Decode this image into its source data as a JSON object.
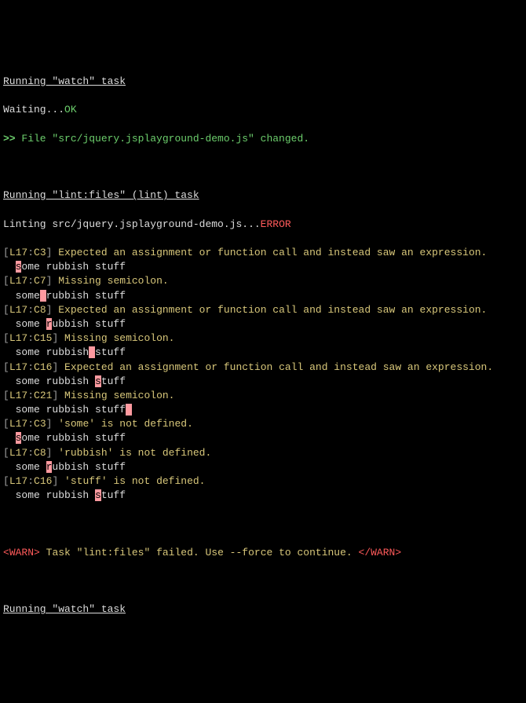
{
  "header": {
    "watch_task": "Running \"watch\" task",
    "waiting": "Waiting...",
    "ok": "OK",
    "file_changed_prefix": ">> ",
    "file_changed": "File \"src/jquery.jsplayground-demo.js\" changed."
  },
  "lint": {
    "task_header": "Running \"lint:files\" (lint) task",
    "linting_prefix": "Linting ",
    "linting_file": "src/jquery.jsplayground-demo.js",
    "linting_suffix": "...",
    "error_label": "ERROR"
  },
  "errors": [
    {
      "loc_open": "[",
      "line": "L17",
      "colon": ":",
      "col": "C3",
      "loc_close": "]",
      "msg": " Expected an assignment or function call and instead saw an expression.",
      "ctx_pre": "  ",
      "ctx_hl": "s",
      "ctx_post": "ome rubbish stuff"
    },
    {
      "loc_open": "[",
      "line": "L17",
      "colon": ":",
      "col": "C7",
      "loc_close": "]",
      "msg": " Missing semicolon.",
      "ctx_pre": "  some",
      "ctx_hl": " ",
      "ctx_post": "rubbish stuff"
    },
    {
      "loc_open": "[",
      "line": "L17",
      "colon": ":",
      "col": "C8",
      "loc_close": "]",
      "msg": " Expected an assignment or function call and instead saw an expression.",
      "ctx_pre": "  some ",
      "ctx_hl": "r",
      "ctx_post": "ubbish stuff"
    },
    {
      "loc_open": "[",
      "line": "L17",
      "colon": ":",
      "col": "C15",
      "loc_close": "]",
      "msg": " Missing semicolon.",
      "ctx_pre": "  some rubbish",
      "ctx_hl": " ",
      "ctx_post": "stuff"
    },
    {
      "loc_open": "[",
      "line": "L17",
      "colon": ":",
      "col": "C16",
      "loc_close": "]",
      "msg": " Expected an assignment or function call and instead saw an expression.",
      "ctx_pre": "  some rubbish ",
      "ctx_hl": "s",
      "ctx_post": "tuff"
    },
    {
      "loc_open": "[",
      "line": "L17",
      "colon": ":",
      "col": "C21",
      "loc_close": "]",
      "msg": " Missing semicolon.",
      "ctx_pre": "  some rubbish stuff",
      "ctx_hl": " ",
      "ctx_post": ""
    },
    {
      "loc_open": "[",
      "line": "L17",
      "colon": ":",
      "col": "C3",
      "loc_close": "]",
      "msg": " 'some' is not defined.",
      "ctx_pre": "  ",
      "ctx_hl": "s",
      "ctx_post": "ome rubbish stuff"
    },
    {
      "loc_open": "[",
      "line": "L17",
      "colon": ":",
      "col": "C8",
      "loc_close": "]",
      "msg": " 'rubbish' is not defined.",
      "ctx_pre": "  some ",
      "ctx_hl": "r",
      "ctx_post": "ubbish stuff"
    },
    {
      "loc_open": "[",
      "line": "L17",
      "colon": ":",
      "col": "C16",
      "loc_close": "]",
      "msg": " 'stuff' is not defined.",
      "ctx_pre": "  some rubbish ",
      "ctx_hl": "s",
      "ctx_post": "tuff"
    }
  ],
  "warn": {
    "open": "<",
    "tag": "WARN",
    "close": ">",
    "msg": " Task \"lint:files\" failed. Use --force to continue. ",
    "open2": "</",
    "tag2": "WARN",
    "close2": ">"
  },
  "footer": {
    "watch_task": "Running \"watch\" task"
  }
}
